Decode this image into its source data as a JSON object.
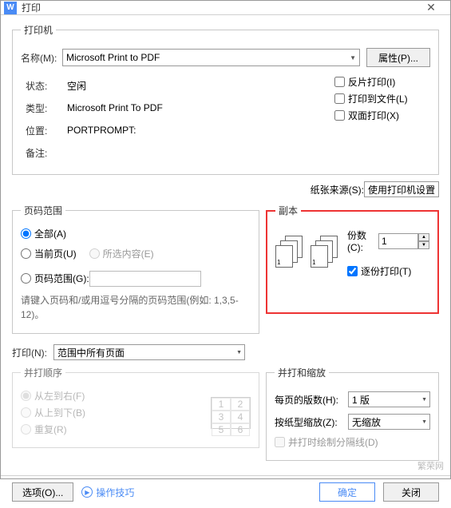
{
  "window": {
    "title": "打印",
    "app_icon": "W"
  },
  "printer": {
    "legend": "打印机",
    "name_label": "名称(M):",
    "name_value": "Microsoft Print to PDF",
    "properties_btn": "属性(P)...",
    "status_label": "状态:",
    "status_value": "空闲",
    "type_label": "类型:",
    "type_value": "Microsoft Print To PDF",
    "where_label": "位置:",
    "where_value": "PORTPROMPT:",
    "comment_label": "备注:",
    "reverse": "反片打印(I)",
    "to_file": "打印到文件(L)",
    "duplex": "双面打印(X)"
  },
  "paper_source": {
    "label": "纸张来源(S):",
    "value": "使用打印机设置"
  },
  "range": {
    "legend": "页码范围",
    "all": "全部(A)",
    "current": "当前页(U)",
    "selection": "所选内容(E)",
    "pages": "页码范围(G):",
    "hint": "请键入页码和/或用逗号分隔的页码范围(例如: 1,3,5-12)。"
  },
  "copies": {
    "legend": "副本",
    "count_label": "份数(C):",
    "count_value": "1",
    "collate": "逐份打印(T)"
  },
  "print_what": {
    "label": "打印(N):",
    "value": "范围中所有页面"
  },
  "zoom": {
    "legend": "并打和缩放",
    "per_sheet_label": "每页的版数(H):",
    "per_sheet_value": "1 版",
    "scale_label": "按纸型缩放(Z):",
    "scale_value": "无缩放",
    "draw_lines": "并打时绘制分隔线(D)"
  },
  "order": {
    "legend": "并打顺序",
    "lr": "从左到右(F)",
    "tb": "从上到下(B)",
    "repeat": "重复(R)"
  },
  "buttons": {
    "options": "选项(O)...",
    "tips": "操作技巧",
    "ok": "确定",
    "cancel": "关闭"
  },
  "watermark": "繁荣网"
}
